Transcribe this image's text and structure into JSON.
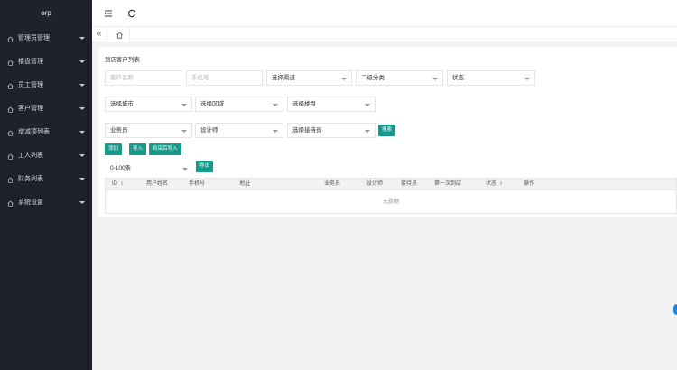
{
  "sidebar": {
    "brand": "erp",
    "items": [
      {
        "label": "管理员管理"
      },
      {
        "label": "楼盘管理"
      },
      {
        "label": "员工管理"
      },
      {
        "label": "客户管理"
      },
      {
        "label": "增减项列表"
      },
      {
        "label": "工人列表"
      },
      {
        "label": "财务列表"
      },
      {
        "label": "系统设置"
      }
    ]
  },
  "topbar": {
    "menu_icon": "fold-menu-icon",
    "refresh_icon": "refresh-icon"
  },
  "tabs": {
    "prev_icon": "double-chevron-left-icon",
    "home_icon": "home-icon",
    "prev_glyph": "«"
  },
  "card": {
    "title": "到店客户列表",
    "filters": {
      "customer_name_placeholder": "客户名称",
      "phone_placeholder": "手机号",
      "channel": "选择渠道",
      "category": "二级分类",
      "status": "状态",
      "city": "选择城市",
      "area": "选择区域",
      "building": "选择楼盘",
      "salesman": "业务员",
      "designer": "设计师",
      "receptionist": "选择接待员"
    },
    "buttons": {
      "search": "搜索",
      "add": "添加",
      "import": "导入",
      "import_after_visit": "到店后导入",
      "export": "导出"
    },
    "range_select": "0-100条",
    "table": {
      "columns": [
        "ID",
        "用户姓名",
        "手机号",
        "地址",
        "业务员",
        "设计师",
        "接待员",
        "第一次到店",
        "状态",
        "操作"
      ],
      "empty_text": "无数据"
    }
  },
  "colors": {
    "sidebar_bg": "#20222a",
    "accent": "#169a8a",
    "page_bg": "#f2f2f2"
  }
}
